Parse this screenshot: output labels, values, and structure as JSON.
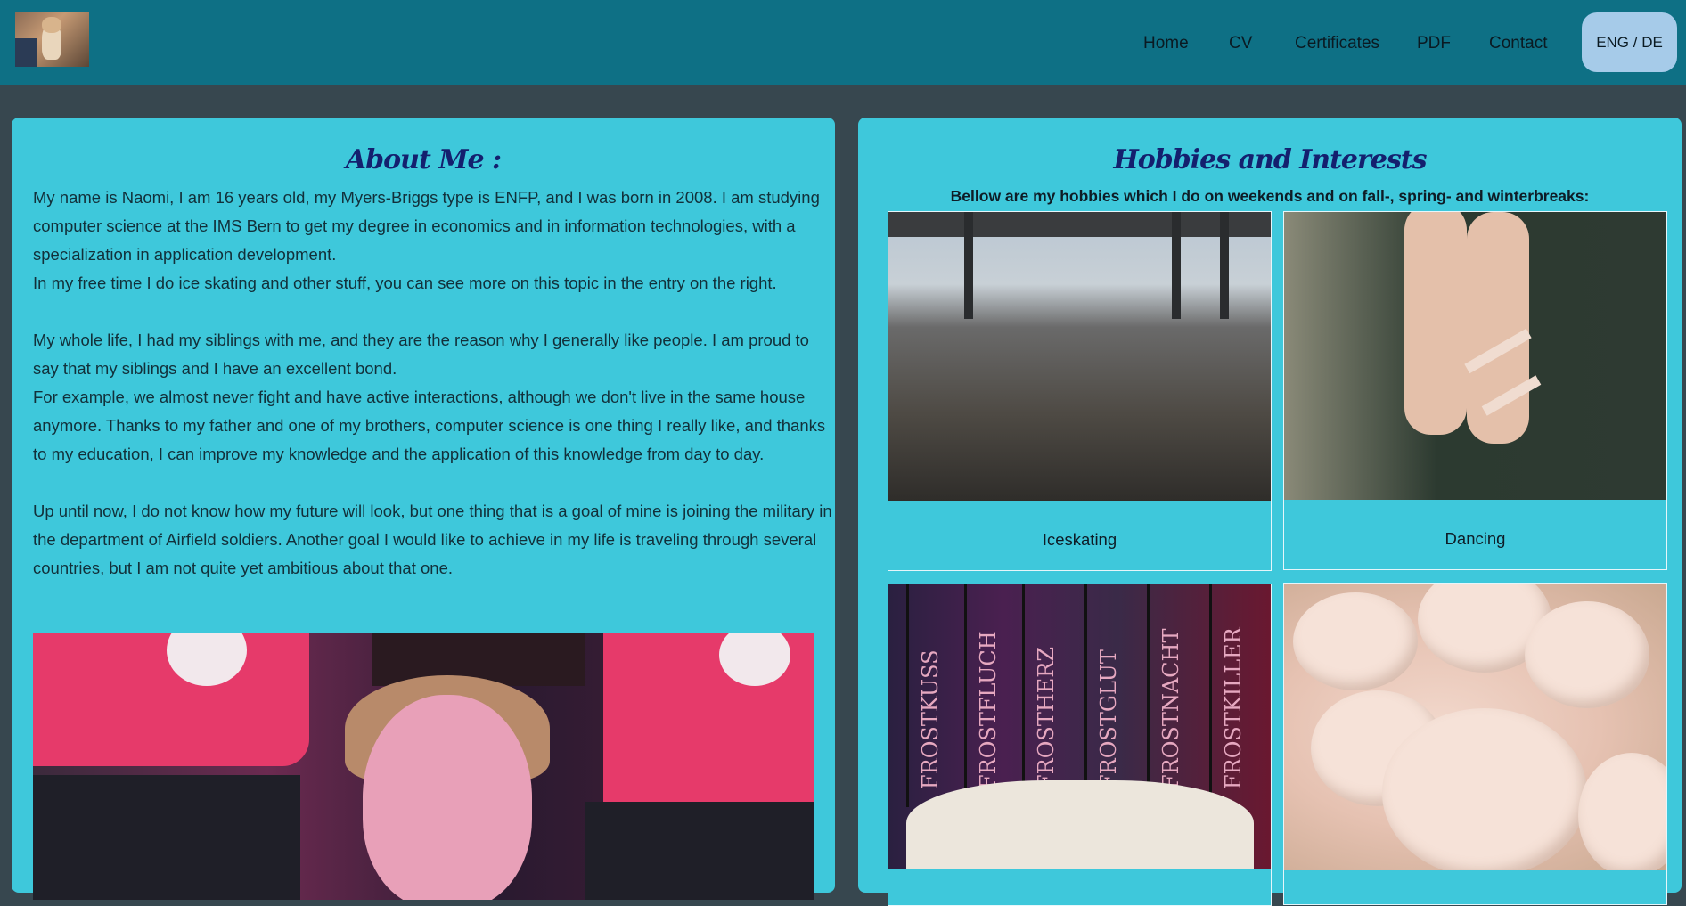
{
  "header": {
    "nav": [
      "Home",
      "CV",
      "Certificates",
      "PDF",
      "Contact"
    ],
    "lang_button": "ENG / DE"
  },
  "about": {
    "title": "About Me :",
    "paragraphs": [
      "My name is Naomi, I am 16 years old, my Myers-Briggs type is ENFP, and I was born in 2008. I am studying computer science at the IMS Bern to get my degree in economics and in information technologies, with a specialization in application development.",
      "In my free time I do ice skating and other stuff, you can see more on this topic in the entry on the right.",
      "My whole life, I had my siblings with me, and they are the reason why I generally like people. I am proud to say that my siblings and I have an excellent bond.",
      "For example, we almost never fight and have active interactions, although we don't live in the same house anymore. Thanks to my father and one of my brothers, computer science is one thing I really like, and thanks to my education, I can improve my knowledge and the application of this knowledge from day to day.",
      "Up until now, I do not know how my future will look, but one thing that is a goal of mine is joining the military in the department of Airfield soldiers. Another goal I would like to achieve in my life is traveling through several countries, but I am not quite yet ambitious about that one."
    ]
  },
  "hobbies": {
    "title": "Hobbies and Interests",
    "subtitle": "Bellow are my hobbies which I do on weekends and on fall-, spring- and winterbreaks:",
    "cards": [
      {
        "caption": "Iceskating"
      },
      {
        "caption": "Dancing"
      }
    ],
    "book_titles": [
      "FROSTKUSS",
      "FROSTFLUCH",
      "FROSTHERZ",
      "FROSTGLUT",
      "FROSTNACHT",
      "FROSTKILLER"
    ]
  }
}
